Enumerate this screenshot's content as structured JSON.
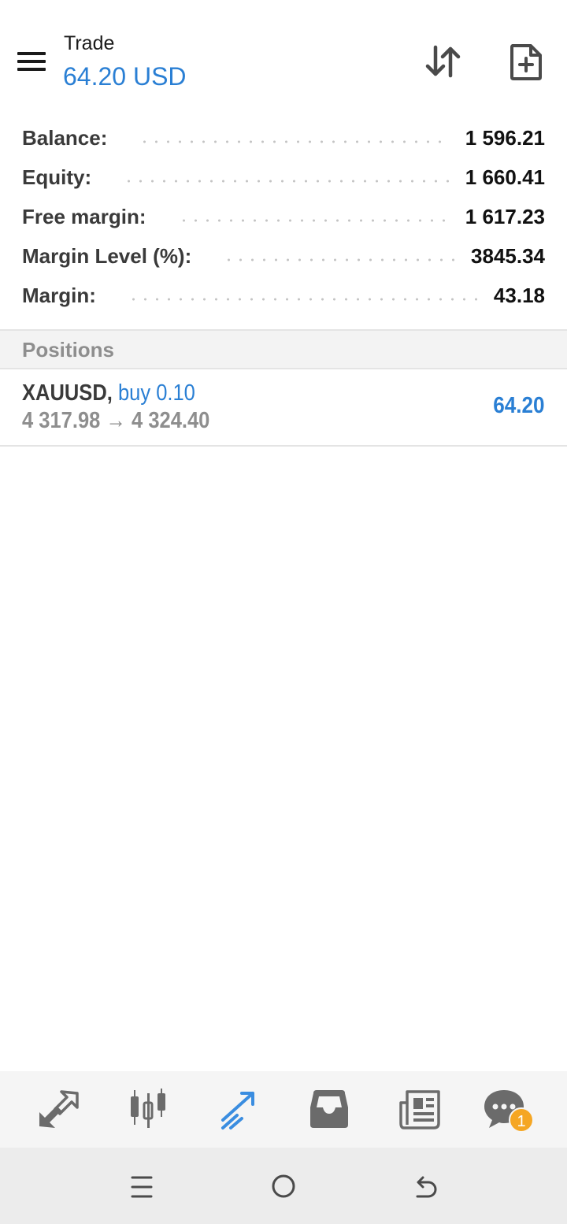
{
  "header": {
    "title": "Trade",
    "profit": "64.20 USD",
    "icons": {
      "menu": "hamburger-menu-icon",
      "sort": "sort-arrows-icon",
      "new_order": "new-document-icon"
    }
  },
  "summary": [
    {
      "label": "Balance:",
      "value": "1 596.21"
    },
    {
      "label": "Equity:",
      "value": "1 660.41"
    },
    {
      "label": "Free margin:",
      "value": "1 617.23"
    },
    {
      "label": "Margin Level (%):",
      "value": "3845.34"
    },
    {
      "label": "Margin:",
      "value": "43.18"
    }
  ],
  "positions": {
    "header": "Positions",
    "items": [
      {
        "symbol": "XAUUSD",
        "comma": ",",
        "type": "buy 0.10",
        "prices": "4 317.98 → 4 324.40",
        "profit": "64.20"
      }
    ]
  },
  "bottom_nav": {
    "items": [
      {
        "name": "quotes-icon",
        "active": false
      },
      {
        "name": "chart-icon",
        "active": false
      },
      {
        "name": "trade-icon",
        "active": true
      },
      {
        "name": "history-icon",
        "active": false
      },
      {
        "name": "news-icon",
        "active": false
      },
      {
        "name": "chat-icon",
        "active": false
      }
    ],
    "chat_badge": "1"
  },
  "colors": {
    "accent": "#2a7fd4",
    "icon_gray": "#6b6b6b",
    "badge": "#f5a623"
  }
}
